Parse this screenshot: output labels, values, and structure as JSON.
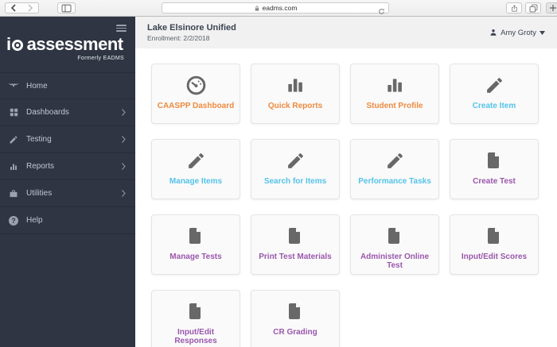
{
  "browser": {
    "url": "eadms.com"
  },
  "sidebar": {
    "logo": {
      "prefix": "i",
      "word": "assessment",
      "tagline": "Formerly EADMS"
    },
    "help_glyph": "?",
    "items": [
      {
        "label": "Home",
        "icon": "home-icon",
        "has_submenu": false
      },
      {
        "label": "Dashboards",
        "icon": "dashboards-icon",
        "has_submenu": true
      },
      {
        "label": "Testing",
        "icon": "pencil-icon",
        "has_submenu": true
      },
      {
        "label": "Reports",
        "icon": "bar-chart-icon",
        "has_submenu": true
      },
      {
        "label": "Utilities",
        "icon": "briefcase-icon",
        "has_submenu": true
      },
      {
        "label": "Help",
        "icon": "question-icon",
        "has_submenu": false
      }
    ]
  },
  "header": {
    "district": "Lake Elsinore Unified",
    "enrollment": "Enrollment: 2/2/2018",
    "user": "Amy Groty"
  },
  "cards": [
    {
      "label": "CAASPP Dashboard",
      "icon": "gauge-icon",
      "color": "#ee8a3f"
    },
    {
      "label": "Quick Reports",
      "icon": "bar-chart-icon",
      "color": "#ee8a3f"
    },
    {
      "label": "Student Profile",
      "icon": "bar-chart-icon",
      "color": "#ee8a3f"
    },
    {
      "label": "Create Item",
      "icon": "pencil-icon",
      "color": "#54c3e8"
    },
    {
      "label": "Manage Items",
      "icon": "pencil-icon",
      "color": "#54c3e8"
    },
    {
      "label": "Search for Items",
      "icon": "pencil-icon",
      "color": "#54c3e8"
    },
    {
      "label": "Performance Tasks",
      "icon": "pencil-icon",
      "color": "#54c3e8"
    },
    {
      "label": "Create Test",
      "icon": "file-icon",
      "color": "#9a57ad"
    },
    {
      "label": "Manage Tests",
      "icon": "file-icon",
      "color": "#9a57ad"
    },
    {
      "label": "Print Test Materials",
      "icon": "file-icon",
      "color": "#9a57ad"
    },
    {
      "label": "Administer Online Test",
      "icon": "file-icon",
      "color": "#9a57ad"
    },
    {
      "label": "Input/Edit Scores",
      "icon": "file-icon",
      "color": "#9a57ad"
    },
    {
      "label": "Input/Edit Responses",
      "icon": "file-icon",
      "color": "#9a57ad"
    },
    {
      "label": "CR Grading",
      "icon": "file-icon",
      "color": "#9a57ad"
    }
  ],
  "colors": {
    "sidebar_bg": "#2f3542",
    "header_bg": "#f1f1f2",
    "accent_orange": "#ee8a3f",
    "accent_blue": "#54c3e8",
    "accent_purple": "#9a57ad",
    "card_icon_gray": "#686868"
  }
}
